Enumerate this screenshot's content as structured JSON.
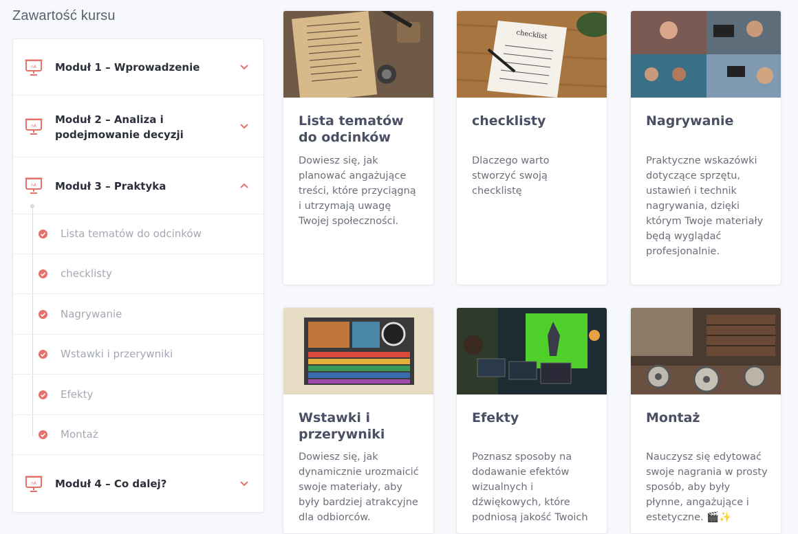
{
  "sidebar": {
    "title": "Zawartość kursu",
    "modules": [
      {
        "label": "Moduł 1 – Wprowadzenie",
        "expanded": false
      },
      {
        "label": "Moduł 2 – Analiza i podejmowanie decyzji",
        "expanded": false
      },
      {
        "label": "Moduł 3 – Praktyka",
        "expanded": true
      },
      {
        "label": "Moduł 4 – Co dalej?",
        "expanded": false
      }
    ],
    "lessons": [
      "Lista tematów do odcinków",
      "checklisty",
      "Nagrywanie",
      "Wstawki i przerywniki",
      "Efekty",
      "Montaż"
    ]
  },
  "cards": [
    {
      "title": "Lista tematów do odcinków",
      "desc": "Dowiesz się, jak planować angażujące treści, które przyciągną i utrzymają uwagę Twojej społeczności.",
      "thumb": "notebook-icon"
    },
    {
      "title": "checklisty",
      "desc": "Dlaczego warto stworzyć swoją checklistę",
      "thumb": "checklist-icon"
    },
    {
      "title": "Nagrywanie",
      "desc": "Praktyczne wskazówki dotyczące sprzętu, ustawień i technik nagrywania, dzięki którym Twoje materiały będą wyglądać profesjonalnie.",
      "thumb": "camera-icon"
    },
    {
      "title": "Wstawki i przerywniki",
      "desc": "Dowiesz się, jak dynamicznie urozmaicić swoje materiały, aby były bardziej atrakcyjne dla odbiorców.",
      "thumb": "timeline-icon"
    },
    {
      "title": "Efekty",
      "desc": "Poznasz sposoby na dodawanie efektów wizualnych i dźwiękowych, które podniosą jakość Twoich",
      "thumb": "green-screen-icon"
    },
    {
      "title": "Montaż",
      "desc": "Nauczysz się edytować swoje nagrania w prosty sposób, aby były płynne, angażujące i estetyczne. 🎬✨",
      "thumb": "film-reel-icon"
    }
  ],
  "colors": {
    "accent": "#e5716b",
    "title": "#4a4f63",
    "muted": "#a4a8b2"
  }
}
